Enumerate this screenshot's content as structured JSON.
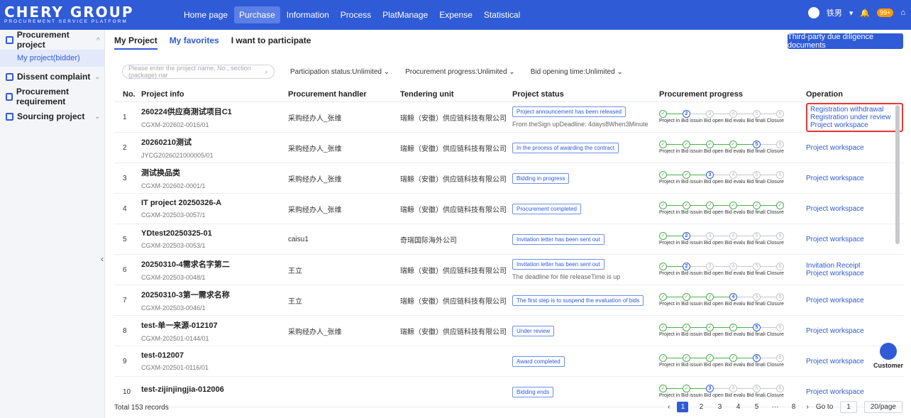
{
  "brand": {
    "title": "CHERY GROUP",
    "subtitle": "PROCUREMENT SERVICE PLATFORM"
  },
  "nav": [
    "Home page",
    "Purchase",
    "Information",
    "Process",
    "PlatManage",
    "Expense",
    "Statistical"
  ],
  "top": {
    "user": "铁男",
    "badge": "99+"
  },
  "sidebar": {
    "groups": [
      "Procurement project",
      "Dissent complaint",
      "Procurement requirement",
      "Sourcing project"
    ],
    "selected": "My project(bidder)"
  },
  "tabs": [
    "My Project",
    "My favorites",
    "I want to participate"
  ],
  "due_btn": "Third-party due diligence documents",
  "filters": {
    "search_placeholder": "Please enter the project name, No., section (package) nar",
    "participation": "Participation status:Unlimited",
    "progress": "Procurement progress:Unlimited",
    "opening": "Bid opening time:Unlimited"
  },
  "headers": [
    "No.",
    "Project info",
    "Procurement handler",
    "Tendering unit",
    "Project status",
    "Procurement progress",
    "Operation"
  ],
  "stage_labels": "Project in Bid issuin Bid open Bid evalu Bid finali Closure",
  "rows": [
    {
      "no": "1",
      "name": "260224供应商测试项目C1",
      "code": "CGXM-202602-0016/01",
      "handler": "采购经办人_张维",
      "unit": "瑞鲸（安徽）供应链科技有限公司",
      "status": "Project announcement has been released",
      "status_note": "From theSign upDeadline: 4days8When3Minute",
      "stage": 2,
      "ops": [
        "Registration withdrawal",
        "Registration under review",
        "Project workspace"
      ]
    },
    {
      "no": "2",
      "name": "20260210测试",
      "code": "JYCG2026021000005/01",
      "handler": "采购经办人_张维",
      "unit": "瑞鲸（安徽）供应链科技有限公司",
      "status": "In the process of awarding the contract",
      "status_note": "",
      "stage": 5,
      "ops": [
        "Project workspace"
      ]
    },
    {
      "no": "3",
      "name": "测试换品类",
      "code": "CGXM-202602-0001/1",
      "handler": "采购经办人_张维",
      "unit": "瑞鲸（安徽）供应链科技有限公司",
      "status": "Bidding in progress",
      "status_note": "",
      "stage": 3,
      "ops": [
        "Project workspace"
      ]
    },
    {
      "no": "4",
      "name": "IT project 20250326-A",
      "code": "CGXM-202503-0057/1",
      "handler": "采购经办人_张维",
      "unit": "瑞鲸（安徽）供应链科技有限公司",
      "status": "Procurement completed",
      "status_note": "",
      "stage": 7,
      "ops": [
        "Project workspace"
      ]
    },
    {
      "no": "5",
      "name": "YDtest20250325-01",
      "code": "CGXM-202503-0053/1",
      "handler": "caisu1",
      "unit": "奇瑞国际海外公司",
      "status": "Invitation letter has been sent out",
      "status_note": "",
      "stage": 2,
      "ops": [
        "Project workspace"
      ]
    },
    {
      "no": "6",
      "name": "20250310-4需求名字第二",
      "code": "CGXM-202503-0048/1",
      "handler": "王立",
      "unit": "瑞鲸（安徽）供应链科技有限公司",
      "status": "Invitation letter has been sent out",
      "status_note": "The deadline for file releaseTime is up",
      "stage": 2,
      "ops": [
        "Invitation Receipt",
        "Project workspace"
      ]
    },
    {
      "no": "7",
      "name": "20250310-3第一需求名称",
      "code": "CGXM-202503-0046/1",
      "handler": "王立",
      "unit": "瑞鲸（安徽）供应链科技有限公司",
      "status": "The first step is to suspend the evaluation of bids",
      "status_note": "",
      "stage": 4,
      "ops": [
        "Project workspace"
      ]
    },
    {
      "no": "8",
      "name": "test-单一来源-012107",
      "code": "CGXM-202501-0144/01",
      "handler": "采购经办人_张维",
      "unit": "瑞鲸（安徽）供应链科技有限公司",
      "status": "Under review",
      "status_note": "",
      "stage": 5,
      "ops": [
        "Project workspace"
      ]
    },
    {
      "no": "9",
      "name": "test-012007",
      "code": "CGXM-202501-0116/01",
      "handler": "",
      "unit": "",
      "status": "Award completed",
      "status_note": "",
      "stage": 5,
      "ops": [
        "Project workspace"
      ]
    },
    {
      "no": "10",
      "name": "test-zijinjingjia-012006",
      "code": "",
      "handler": "",
      "unit": "",
      "status": "Bidding ends",
      "status_note": "",
      "stage": 3,
      "ops": [
        "Project workspace"
      ]
    }
  ],
  "footer": {
    "total": "Total 153 records",
    "pages": [
      "1",
      "2",
      "3",
      "4",
      "5",
      "···",
      "8"
    ],
    "goto": "Go to",
    "goto_val": "1",
    "page_size": "20/page"
  },
  "customer": "Customer"
}
